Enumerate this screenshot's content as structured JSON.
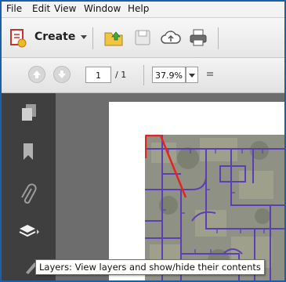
{
  "menubar": {
    "items": [
      "File",
      "Edit",
      "View",
      "Window",
      "Help"
    ]
  },
  "toolbar": {
    "create_label": "Create"
  },
  "navigation": {
    "current_page": "1",
    "total_pages": "/ 1",
    "zoom_value": "37.9%"
  },
  "tooltip": {
    "text": "Layers: View layers and show/hide their contents"
  },
  "colors": {
    "window_border": "#1b5fa8",
    "sidebar_bg": "#3f3f3f",
    "doc_bg": "#6d6d6d",
    "road": "#5b3fb6",
    "boundary": "#e62323"
  }
}
